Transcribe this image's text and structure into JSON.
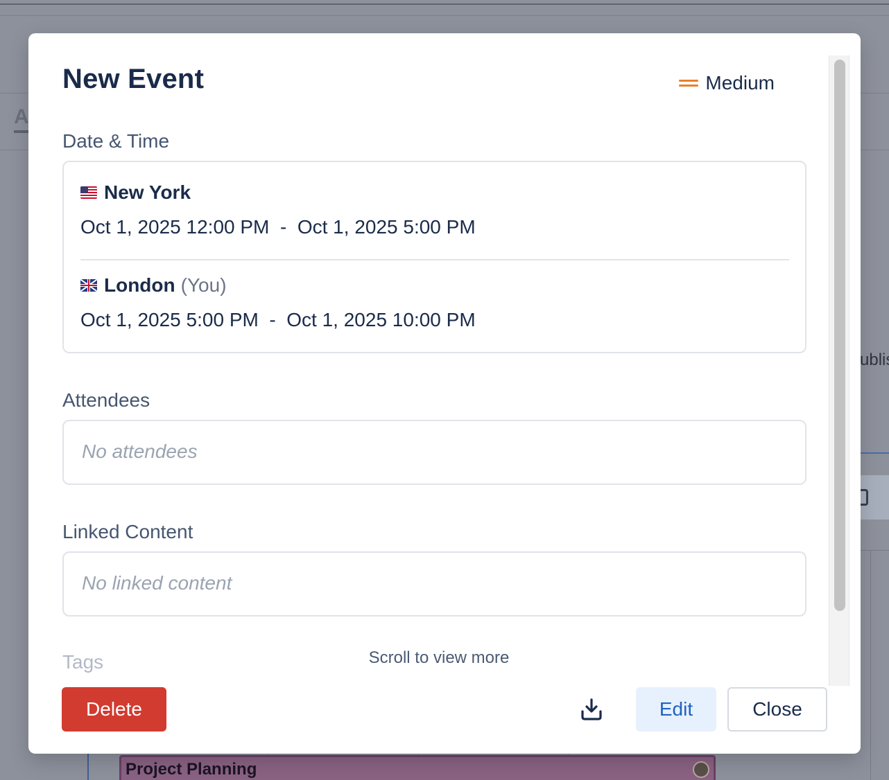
{
  "background": {
    "tab_fragment": "A",
    "text_fragment": "ublis",
    "event_title": "Project Planning"
  },
  "modal": {
    "title": "New Event",
    "priority": {
      "label": "Medium",
      "icon": "priority-medium-icon",
      "color": "#e8812a"
    },
    "date_time": {
      "label": "Date & Time",
      "zones": [
        {
          "flag": "us-flag-icon",
          "city": "New York",
          "suffix": "",
          "start": "Oct 1, 2025 12:00 PM",
          "separator": "-",
          "end": "Oct 1, 2025 5:00 PM"
        },
        {
          "flag": "uk-flag-icon",
          "city": "London",
          "suffix": "(You)",
          "start": "Oct 1, 2025 5:00 PM",
          "separator": "-",
          "end": "Oct 1, 2025 10:00 PM"
        }
      ]
    },
    "attendees": {
      "label": "Attendees",
      "empty": "No attendees"
    },
    "linked_content": {
      "label": "Linked Content",
      "empty": "No linked content"
    },
    "tags": {
      "label": "Tags"
    },
    "scroll_hint": "Scroll to view more",
    "footer": {
      "delete_label": "Delete",
      "download_icon": "download-icon",
      "edit_label": "Edit",
      "close_label": "Close"
    }
  },
  "colors": {
    "danger": "#d23b30",
    "primary_text": "#1a2b4a",
    "edit_bg": "#e7f1fd",
    "edit_text": "#1f62c2"
  }
}
